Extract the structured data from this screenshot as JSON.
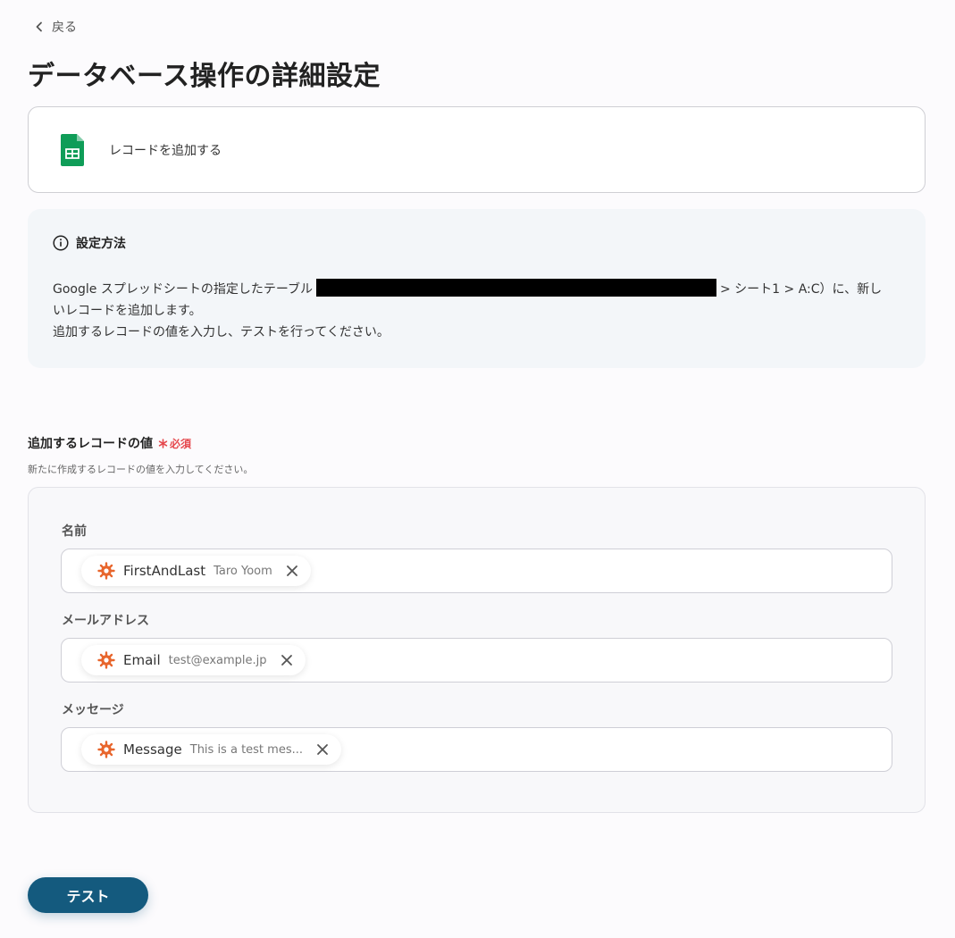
{
  "nav": {
    "back_label": "戻る"
  },
  "page": {
    "title": "データベース操作の詳細設定"
  },
  "action": {
    "label": "レコードを追加する",
    "icon": "google-sheets-icon"
  },
  "info": {
    "heading": "設定方法",
    "line1_prefix": "Google スプレッドシートの指定したテーブル",
    "line1_suffix": "> シート1 > A:C）に、新し",
    "line2": "いレコードを追加します。",
    "line3": "追加するレコードの値を入力し、テストを行ってください。"
  },
  "section": {
    "label": "追加するレコードの値",
    "required_label": "必須",
    "description": "新たに作成するレコードの値を入力してください。"
  },
  "fields": [
    {
      "label": "名前",
      "chip_name": "FirstAndLast",
      "chip_value": "Taro Yoom"
    },
    {
      "label": "メールアドレス",
      "chip_name": "Email",
      "chip_value": "test@example.jp"
    },
    {
      "label": "メッセージ",
      "chip_name": "Message",
      "chip_value": "This is a test mes..."
    }
  ],
  "footer": {
    "test_label": "テスト"
  },
  "colors": {
    "primary": "#145a7e",
    "required": "#e5484d",
    "chip_icon": "#e8662d",
    "sheets_green": "#0f9d58"
  }
}
